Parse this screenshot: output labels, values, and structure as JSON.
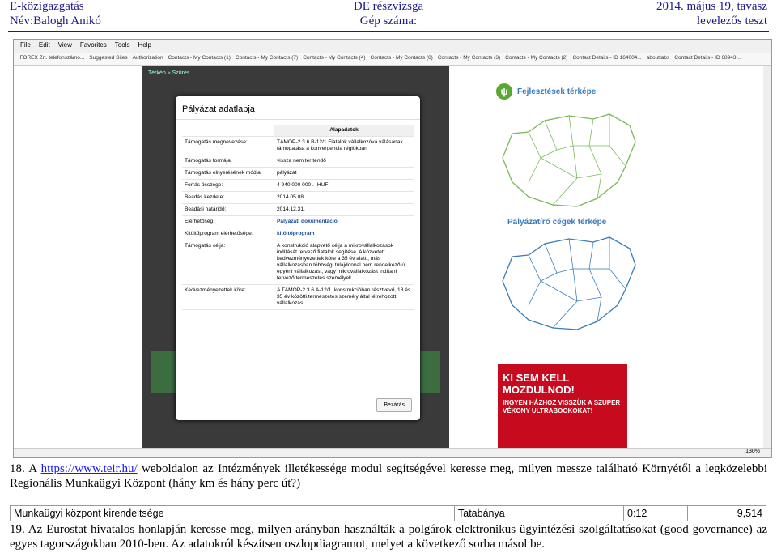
{
  "header": {
    "left1": "E-közigazgatás",
    "center1": "DE részvizsga",
    "right1": "2014. május 19, tavasz",
    "left2": "Név:Balogh Anikó",
    "center2": "Gép száma:",
    "right2": "levelezős teszt"
  },
  "screenshot": {
    "menu": [
      "File",
      "Edit",
      "View",
      "Favorites",
      "Tools",
      "Help"
    ],
    "favorites": [
      "iFOREX Zrt. telefonszámo...",
      "Suggested Sites",
      "Authorization",
      "Contacts - My Contacts (1)",
      "Contacts - My Contacts (7)",
      "Contacts - My Contacts (4)",
      "Contacts - My Contacts (6)",
      "Contacts - My Contacts (3)",
      "Contacts - My Contacts (2)",
      "Contact Details - ID 164004...",
      "abouttabs",
      "Contact Details - ID 68943..."
    ],
    "crumb": "Térkép » Szűrés",
    "modal": {
      "title": "Pályázat adatlapja",
      "section": "Alapadatok",
      "rows": [
        {
          "k": "Támogatás megnevezése:",
          "v": "TÁMOP-2.3.6.B-12/1 Fiatalok vállalkozóvá válásának támogatása a konvergencia régiókban"
        },
        {
          "k": "Támogatás formája:",
          "v": "vissza nem térítendő"
        },
        {
          "k": "Támogatás elnyerésének módja:",
          "v": "pályázat"
        },
        {
          "k": "Forrás összege:",
          "v": "4 940 000 000 .- HUF"
        },
        {
          "k": "Beadás kezdete:",
          "v": "2014.05.08."
        },
        {
          "k": "Beadási határidő:",
          "v": "2014.12.31."
        },
        {
          "k": "Elérhetőség:",
          "v": "Pályázati dokumentáció"
        },
        {
          "k": "Kitöltőprogram elérhetősége:",
          "v": "kitöltőprogram"
        },
        {
          "k": "Támogatás célja:",
          "v": "A konstrukció alapvető célja a mikrovállalkozások indítását tervező fiatalok segítése. A közvetett kedvezményezettek köre a 35 év alatti, más vállalkozásban többségi tulajdonnal nem rendelkező új egyéni vállalkozást, vagy mikrovállalkozást indítani tervező természetes személyek."
        },
        {
          "k": "Kedvezményezettek köre:",
          "v": "A TÁMOP-2.3.6.A-12/1. konstrukcióban résztvevő, 18 és 35 év közötti természetes személy által létrehozott vállalkozás..."
        }
      ],
      "close": "Bezárás"
    },
    "map1_title": "Fejlesztések térképe",
    "map2_title": "Pályázatíró cégek térképe",
    "ad_line1": "KI SEM KELL MOZDULNOD!",
    "ad_line2": "INGYEN HÁZHOZ VISSZÜK A SZUPER VÉKONY ULTRABOOKOKAT!",
    "zoom": "130%"
  },
  "q18": {
    "num": "18. A ",
    "url": "https://www.teir.hu/",
    "text": " weboldalon az Intézmények illetékessége modul segítségével keresse meg, milyen messze található Környétől a legközelebbi Regionális Munkaügyi Központ (hány km és hány perc út?)"
  },
  "answer": [
    "Munkaügyi központ kirendeltsége",
    "Tatabánya",
    "0:12",
    "9,514"
  ],
  "q19": {
    "text": "19. Az Eurostat hivatalos honlapján keresse meg, milyen arányban használták a polgárok elektronikus ügyintézési szolgáltatásokat (good governance) az egyes tagországokban 2010-ben. Az adatokról készítsen oszlopdiagramot, melyet a következő sorba másol be."
  }
}
